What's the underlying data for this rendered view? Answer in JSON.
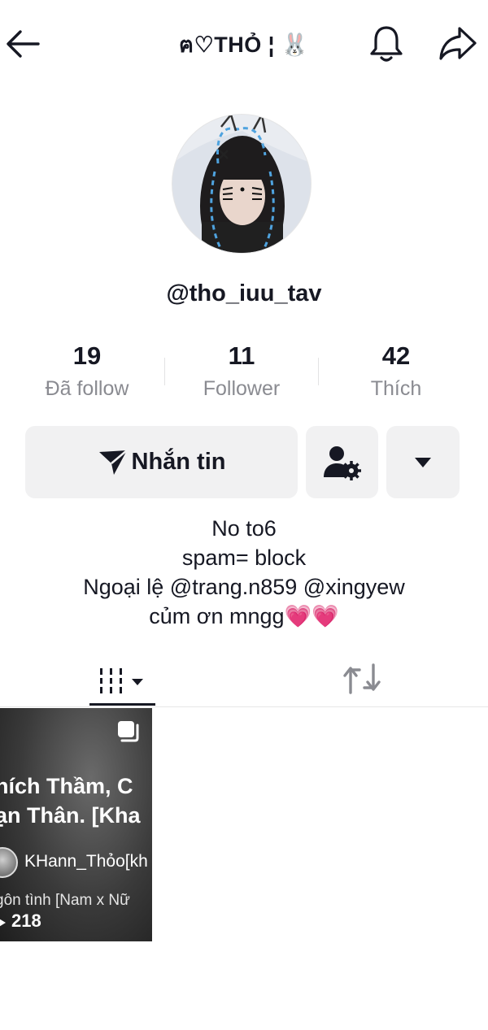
{
  "header": {
    "title": "ฅ♡THỎ ¦ 🐰",
    "icons": [
      "back-arrow-icon",
      "bell-icon",
      "share-icon"
    ]
  },
  "profile": {
    "username": "@tho_iuu_tav"
  },
  "stats": [
    {
      "value": "19",
      "label": "Đã follow"
    },
    {
      "value": "11",
      "label": "Follower"
    },
    {
      "value": "42",
      "label": "Thích"
    }
  ],
  "actions": {
    "message_label": "Nhắn tin"
  },
  "bio": [
    "No to6",
    "spam= block",
    "Ngoại lệ @trang.n859 @xingyew",
    "củm ơn mngg💗💗"
  ],
  "video": {
    "title_line1": "hích Thầm, C",
    "title_line2": "ạn Thân. [Kha",
    "author": "KHann_Thỏo[kh",
    "subtitle": "gôn tình [Nam x Nữ",
    "views": "218"
  },
  "colors": {
    "text": "#161823",
    "muted": "#8a8b91",
    "button_bg": "#f1f1f2"
  }
}
